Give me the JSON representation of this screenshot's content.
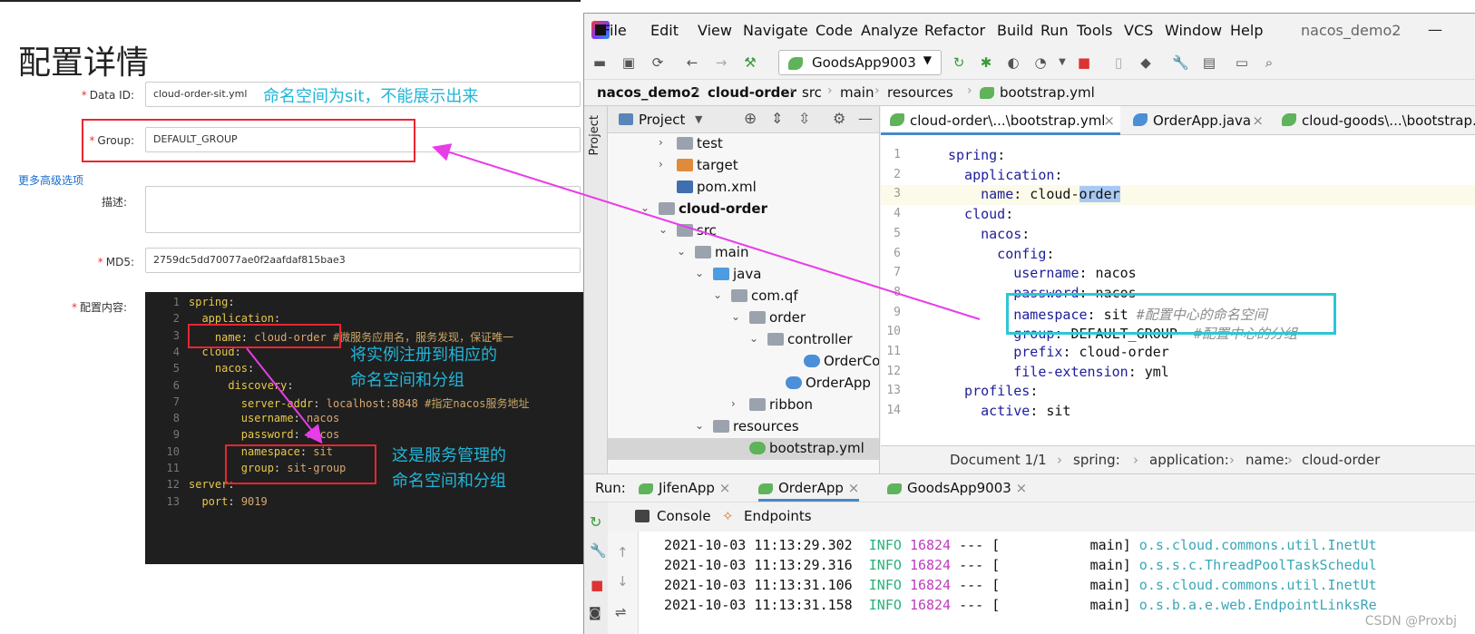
{
  "nacos": {
    "title": "配置详情",
    "data_id_label": "Data ID:",
    "data_id_value": "cloud-order-sit.yml",
    "group_label": "Group:",
    "group_value": "DEFAULT_GROUP",
    "advanced_link": "更多高级选项",
    "desc_label": "描述:",
    "md5_label": "MD5:",
    "md5_value": "2759dc5dd70077ae0f2aafdaf815bae3",
    "content_label": "配置内容:",
    "required_mark": "*",
    "annotation_namespace": "命名空间为sit，不能展示出来",
    "annotation_register_1": "将实例注册到相应的",
    "annotation_register_2": "命名空间和分组",
    "annotation_service_1": "这是服务管理的",
    "annotation_service_2": "命名空间和分组",
    "config_lines": [
      {
        "n": "1",
        "key": "spring",
        "val": "",
        "cm": ""
      },
      {
        "n": "2",
        "key": "  application",
        "val": "",
        "cm": ""
      },
      {
        "n": "3",
        "key": "    name",
        "val": " cloud-order",
        "cm": " #微服务应用名，服务发现，保证唯一"
      },
      {
        "n": "4",
        "key": "  cloud",
        "val": "",
        "cm": ""
      },
      {
        "n": "5",
        "key": "    nacos",
        "val": "",
        "cm": ""
      },
      {
        "n": "6",
        "key": "      discovery",
        "val": "",
        "cm": ""
      },
      {
        "n": "7",
        "key": "        server-addr",
        "val": " localhost:8848",
        "cm": " #指定nacos服务地址"
      },
      {
        "n": "8",
        "key": "        username",
        "val": " nacos",
        "cm": ""
      },
      {
        "n": "9",
        "key": "        password",
        "val": " nacos",
        "cm": ""
      },
      {
        "n": "10",
        "key": "        namespace",
        "val": " sit",
        "cm": ""
      },
      {
        "n": "11",
        "key": "        group",
        "val": " sit-group",
        "cm": ""
      },
      {
        "n": "12",
        "key": "server",
        "val": "",
        "cm": ""
      },
      {
        "n": "13",
        "key": "  port",
        "val": " 9019",
        "cm": ""
      }
    ]
  },
  "ide": {
    "menu": [
      "File",
      "Edit",
      "View",
      "Navigate",
      "Code",
      "Analyze",
      "Refactor",
      "Build",
      "Run",
      "Tools",
      "VCS",
      "Window",
      "Help"
    ],
    "project_name": "nacos_demo2",
    "minimize": "—",
    "run_config": "GoodsApp9003",
    "breadcrumbs": [
      "nacos_demo2",
      "cloud-order",
      "src",
      "main",
      "resources",
      "bootstrap.yml"
    ],
    "project_strip_label": "Project",
    "project_panel_title": "Project",
    "tree": [
      {
        "label": "test",
        "indent": 1,
        "arrow": "›",
        "kind": "folder"
      },
      {
        "label": "target",
        "indent": 1,
        "arrow": "›",
        "kind": "orange"
      },
      {
        "label": "pom.xml",
        "indent": 1,
        "arrow": "",
        "kind": "maven"
      },
      {
        "label": "cloud-order",
        "indent": 0,
        "arrow": "⌄",
        "kind": "module"
      },
      {
        "label": "src",
        "indent": 1,
        "arrow": "⌄",
        "kind": "folder"
      },
      {
        "label": "main",
        "indent": 2,
        "arrow": "⌄",
        "kind": "folder"
      },
      {
        "label": "java",
        "indent": 3,
        "arrow": "⌄",
        "kind": "blue"
      },
      {
        "label": "com.qf",
        "indent": 4,
        "arrow": "⌄",
        "kind": "pkg"
      },
      {
        "label": "order",
        "indent": 5,
        "arrow": "⌄",
        "kind": "pkg"
      },
      {
        "label": "controller",
        "indent": 6,
        "arrow": "⌄",
        "kind": "pkg"
      },
      {
        "label": "OrderCon",
        "indent": 8,
        "arrow": "",
        "kind": "class"
      },
      {
        "label": "OrderApp",
        "indent": 7,
        "arrow": "",
        "kind": "springclass"
      },
      {
        "label": "ribbon",
        "indent": 5,
        "arrow": "›",
        "kind": "pkg"
      },
      {
        "label": "resources",
        "indent": 3,
        "arrow": "⌄",
        "kind": "res"
      },
      {
        "label": "bootstrap.yml",
        "indent": 5,
        "arrow": "",
        "kind": "yml"
      }
    ],
    "editor_tabs": [
      "cloud-order\\...\\bootstrap.yml",
      "OrderApp.java",
      "cloud-goods\\...\\bootstrap.yml"
    ],
    "tab_close": "×",
    "code_lines": [
      {
        "n": "1",
        "key": "spring",
        "val": "",
        "cm": ""
      },
      {
        "n": "2",
        "key": "  application",
        "val": "",
        "cm": ""
      },
      {
        "n": "3",
        "key": "    name",
        "val": " cloud-order",
        "cm": ""
      },
      {
        "n": "4",
        "key": "  cloud",
        "val": "",
        "cm": ""
      },
      {
        "n": "5",
        "key": "    nacos",
        "val": "",
        "cm": ""
      },
      {
        "n": "6",
        "key": "      config",
        "val": "",
        "cm": ""
      },
      {
        "n": "7",
        "key": "        username",
        "val": " nacos",
        "cm": ""
      },
      {
        "n": "8",
        "key": "        password",
        "val": " nacos",
        "cm": ""
      },
      {
        "n": "9",
        "key": "        namespace",
        "val": " sit",
        "cm": " #配置中心的命名空间"
      },
      {
        "n": "10",
        "key": "        group",
        "val": " DEFAULT_GROUP",
        "cm": "  #配置中心的分组"
      },
      {
        "n": "11",
        "key": "        prefix",
        "val": " cloud-order",
        "cm": ""
      },
      {
        "n": "12",
        "key": "        file-extension",
        "val": " yml",
        "cm": ""
      },
      {
        "n": "13",
        "key": "  profiles",
        "val": "",
        "cm": ""
      },
      {
        "n": "14",
        "key": "    active",
        "val": " sit",
        "cm": ""
      }
    ],
    "status_breadcrumb": [
      "Document 1/1",
      "spring:",
      "application:",
      "name:",
      "cloud-order"
    ],
    "run_label": "Run:",
    "run_tabs": [
      "JifenApp",
      "OrderApp",
      "GoodsApp9003"
    ],
    "console_tabs": [
      "Console",
      "Endpoints"
    ],
    "logs": [
      {
        "ts": "2021-10-03 11:13:29.302",
        "level": "INFO",
        "pid": "16824",
        "sep": " --- [",
        "thread": "           main]",
        "cls": " o.s.cloud.commons.util.InetUt"
      },
      {
        "ts": "2021-10-03 11:13:29.316",
        "level": "INFO",
        "pid": "16824",
        "sep": " --- [",
        "thread": "           main]",
        "cls": " o.s.s.c.ThreadPoolTaskSchedul"
      },
      {
        "ts": "2021-10-03 11:13:31.106",
        "level": "INFO",
        "pid": "16824",
        "sep": " --- [",
        "thread": "           main]",
        "cls": " o.s.cloud.commons.util.InetUt"
      },
      {
        "ts": "2021-10-03 11:13:31.158",
        "level": "INFO",
        "pid": "16824",
        "sep": " --- [",
        "thread": "           main]",
        "cls": " o.s.b.a.e.web.EndpointLinksRe"
      }
    ],
    "watermark": "CSDN @Proxbj"
  },
  "colors": {
    "annotation_red": "#e8262f",
    "annotation_cyan": "#2dc6d6",
    "arrow_magenta": "#e83ce8"
  }
}
